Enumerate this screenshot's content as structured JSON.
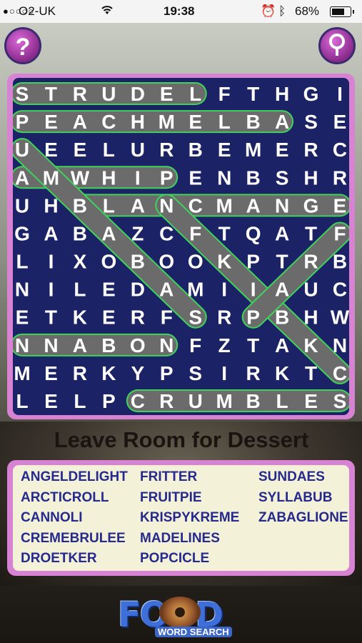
{
  "status_bar": {
    "signal": "●○○○○",
    "carrier": "O2-UK",
    "time": "19:38",
    "battery_text": "68%"
  },
  "buttons": {
    "help_label": "?",
    "hint_icon": "magnifier-icon"
  },
  "grid": {
    "rows": [
      "STRUDELFTHGI",
      "PEACHMELBASE",
      "UEELURBEMERC",
      "AMWHIPENBSHR",
      "UHBLANCMANGE",
      "GABAZCFTQATF",
      "LIXOBOOKPTRB",
      "NILEDAMIIAUC",
      "ETKERFSRPBHW",
      "NNABONFZTAKN",
      "MERKYPSIRKTC",
      "LELPCRUMBLES"
    ],
    "found_words": [
      {
        "word": "STRUDEL",
        "start": [
          0,
          0
        ],
        "end": [
          0,
          6
        ]
      },
      {
        "word": "PEACHMELBA",
        "start": [
          1,
          0
        ],
        "end": [
          1,
          9
        ]
      },
      {
        "word": "AMWHIP",
        "start": [
          3,
          0
        ],
        "end": [
          3,
          5
        ]
      },
      {
        "word": "BLANCMANGE",
        "start": [
          4,
          2
        ],
        "end": [
          4,
          11
        ]
      },
      {
        "word": "NNABON",
        "start": [
          9,
          0
        ],
        "end": [
          9,
          5
        ]
      },
      {
        "word": "CRUMBLES",
        "start": [
          11,
          4
        ],
        "end": [
          11,
          11
        ]
      },
      {
        "word": "DIAG1",
        "start": [
          2,
          0
        ],
        "end": [
          8,
          6
        ]
      },
      {
        "word": "DIAG2",
        "start": [
          4,
          5
        ],
        "end": [
          10,
          11
        ]
      },
      {
        "word": "DIAG3",
        "start": [
          5,
          11
        ],
        "end": [
          8,
          8
        ]
      }
    ],
    "highlight_color": "#6b6b6b",
    "outline_color": "#3fd35a"
  },
  "title": "Leave Room for Dessert",
  "word_list": {
    "col1": [
      "ANGELDELIGHT",
      "ARCTICROLL",
      "CANNOLI",
      "CREMEBRULEE",
      "DROETKER"
    ],
    "col2": [
      "FRITTER",
      "FRUITPIE",
      "KRISPYKREME",
      "MADELINES",
      "POPCICLE"
    ],
    "col3": [
      "SUNDAES",
      "SYLLABUB",
      "ZABAGLIONE"
    ]
  },
  "logo": {
    "main": "FOOD",
    "sub": "WORD SEARCH"
  }
}
